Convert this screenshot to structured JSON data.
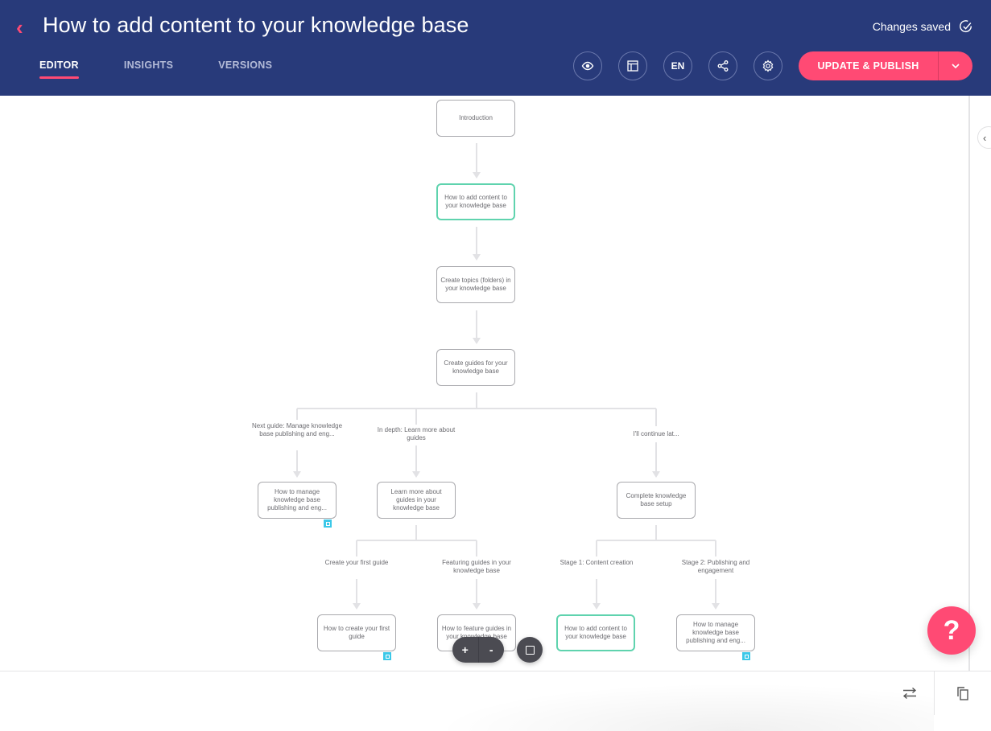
{
  "header": {
    "title": "How to add content to your knowledge base",
    "save_status": "Changes saved",
    "tabs": [
      {
        "label": "EDITOR",
        "active": true
      },
      {
        "label": "INSIGHTS",
        "active": false
      },
      {
        "label": "VERSIONS",
        "active": false
      }
    ],
    "toolbar": {
      "preview_icon": "eye-icon",
      "layout_icon": "layout-icon",
      "language": "EN",
      "share_icon": "share-icon",
      "settings_icon": "gear-icon"
    },
    "publish_label": "UPDATE & PUBLISH"
  },
  "colors": {
    "header_bg": "#283a7a",
    "accent": "#ff4a74",
    "active_node": "#5fd3ae",
    "badge": "#3cc8e8"
  },
  "flow": {
    "nodes": [
      {
        "id": "intro",
        "text": "Introduction",
        "active": false
      },
      {
        "id": "add-content",
        "text": "How to add content to your knowledge base",
        "active": true
      },
      {
        "id": "create-topics",
        "text": "Create topics (folders) in your knowledge base",
        "active": false
      },
      {
        "id": "create-guides",
        "text": "Create guides for your knowledge base",
        "active": false
      },
      {
        "id": "manage-publishing",
        "text": "How to manage knowledge base publishing and eng...",
        "active": false,
        "badge": true
      },
      {
        "id": "learn-guides",
        "text": "Learn more about guides in your knowledge base",
        "active": false
      },
      {
        "id": "complete-setup",
        "text": "Complete knowledge base setup",
        "active": false
      },
      {
        "id": "create-first",
        "text": "How to create your first guide",
        "active": false,
        "badge": true
      },
      {
        "id": "feature-guides",
        "text": "How to feature guides in your knowledge base",
        "active": false
      },
      {
        "id": "add-content-2",
        "text": "How to add content to your knowledge base",
        "active": true
      },
      {
        "id": "manage-publishing-2",
        "text": "How to manage knowledge base publishing and eng...",
        "active": false,
        "badge": true
      }
    ],
    "choices": [
      {
        "text": "Next guide: Manage knowledge base publishing and eng..."
      },
      {
        "text": "In depth: Learn more about guides"
      },
      {
        "text": "I'll continue lat..."
      },
      {
        "text": "Create your first guide"
      },
      {
        "text": "Featuring guides in your knowledge base"
      },
      {
        "text": "Stage 1: Content creation"
      },
      {
        "text": "Stage 2: Publishing and engagement"
      }
    ]
  },
  "controls": {
    "zoom_in": "+",
    "zoom_out": "-",
    "help": "?"
  }
}
